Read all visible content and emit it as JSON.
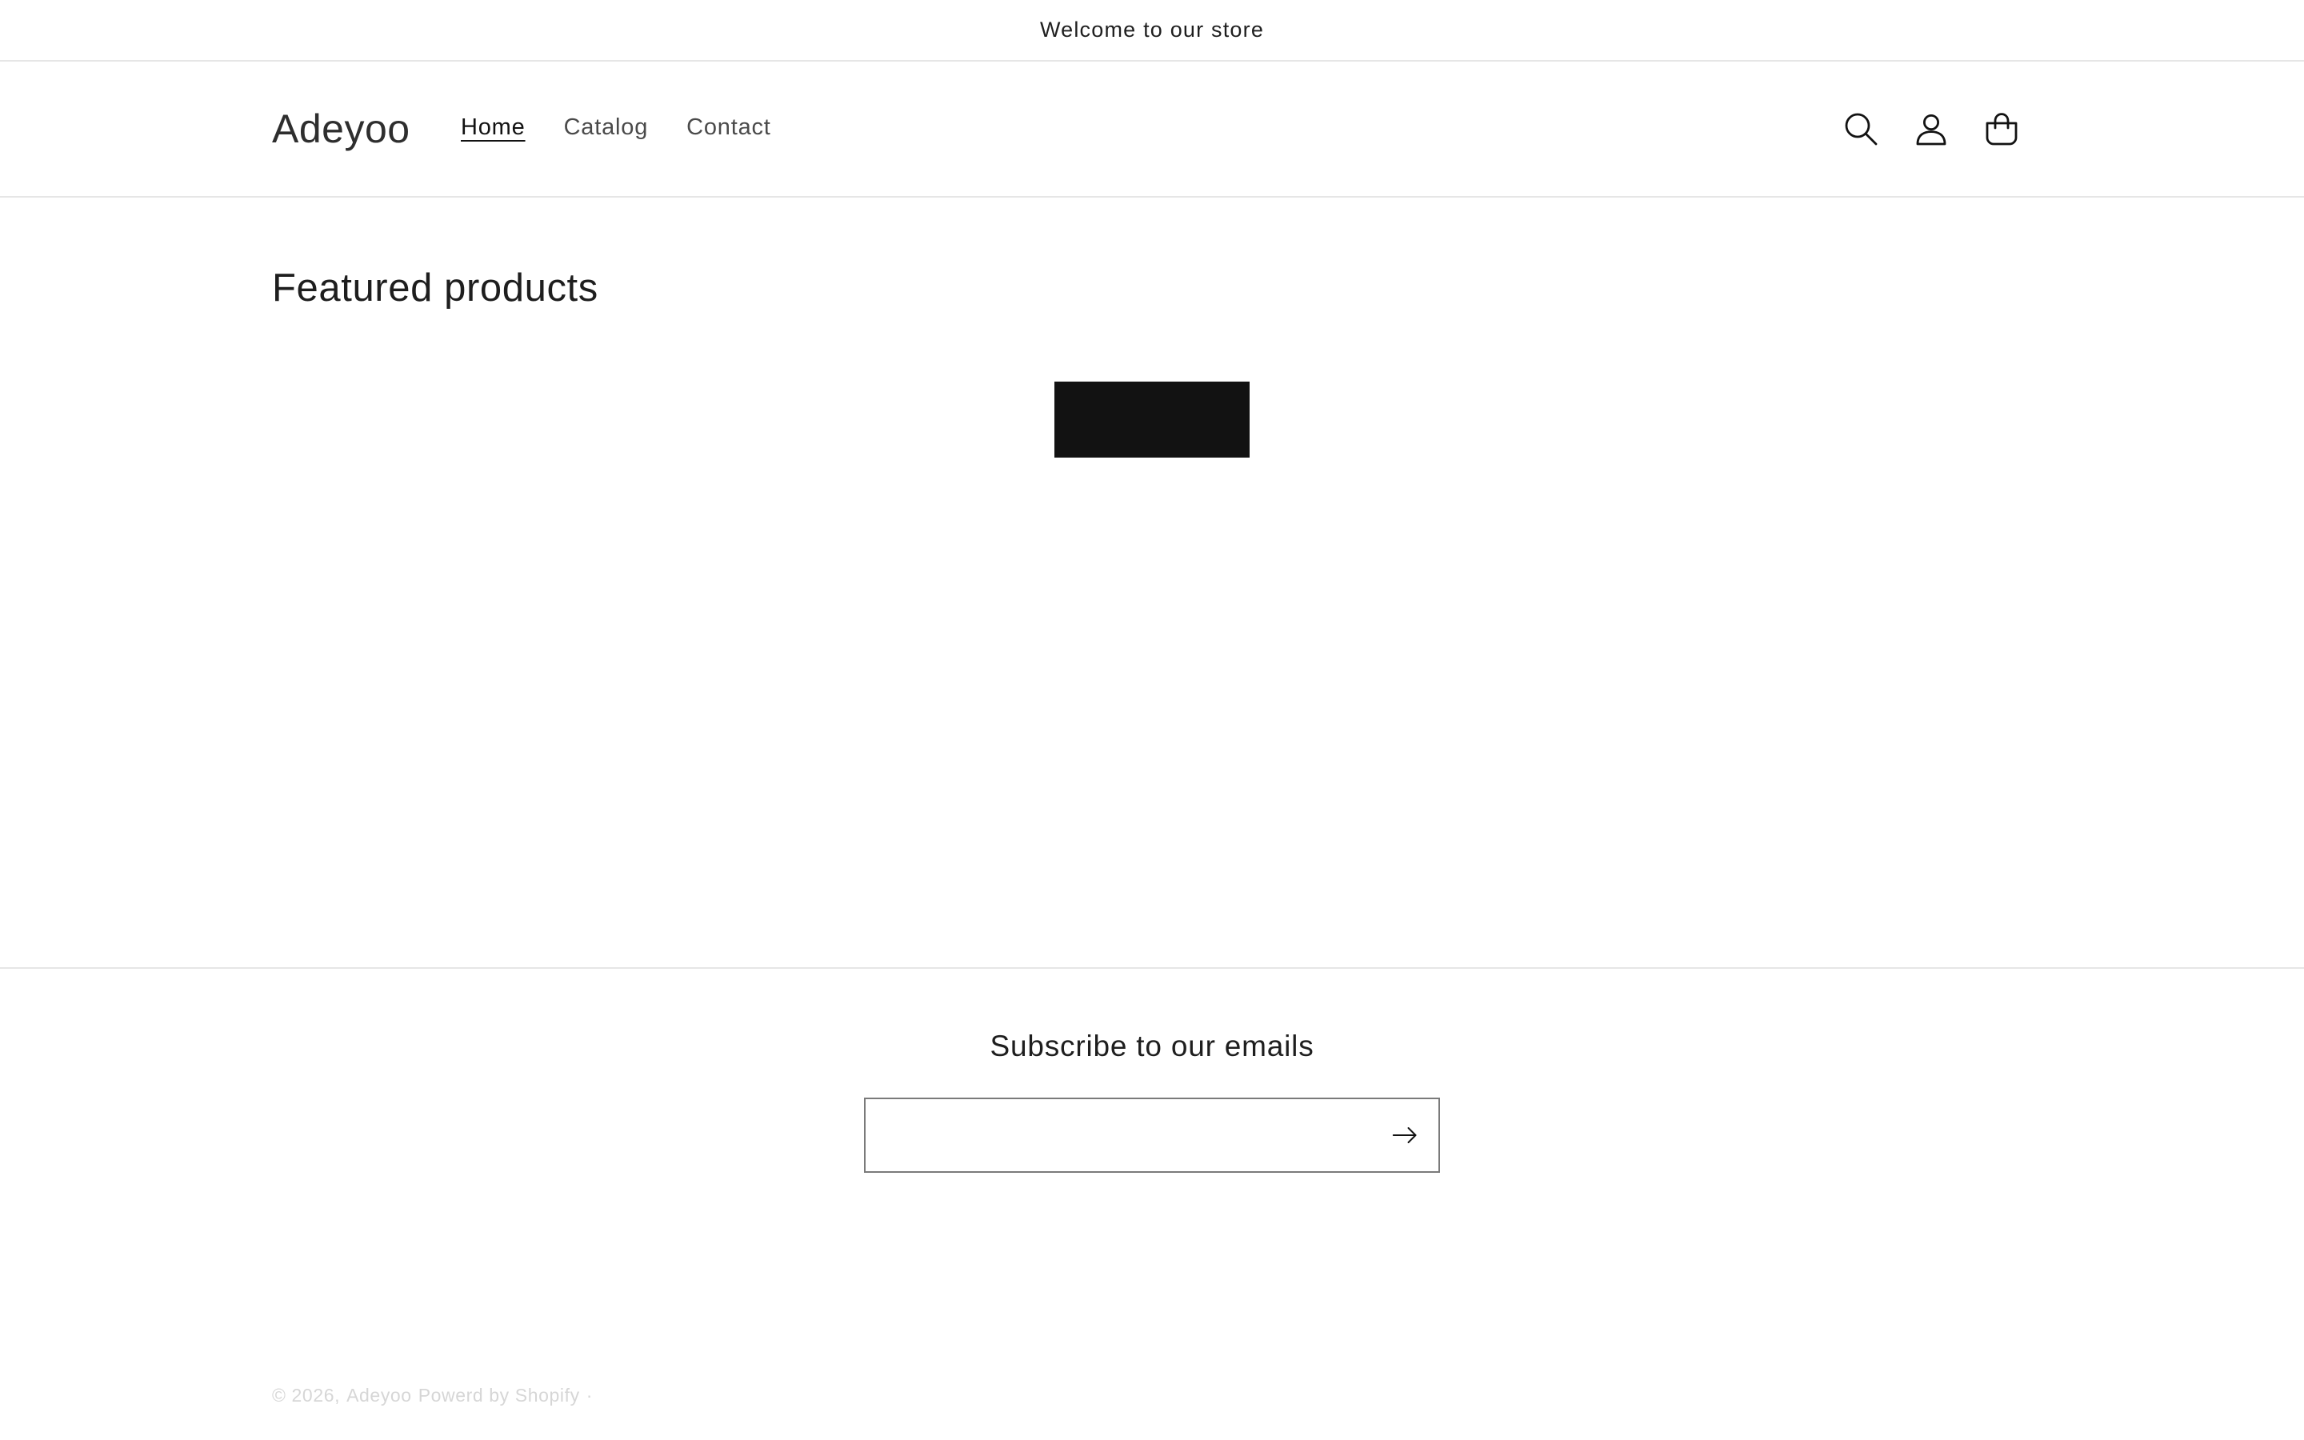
{
  "announcement": {
    "text": "Welcome to our store"
  },
  "header": {
    "logo": "Adeyoo",
    "nav": [
      {
        "label": "Home",
        "active": true
      },
      {
        "label": "Catalog",
        "active": false
      },
      {
        "label": "Contact",
        "active": false
      }
    ],
    "icons": [
      "search-icon",
      "account-icon",
      "cart-icon"
    ]
  },
  "featured": {
    "title": "Featured products",
    "button_label": ""
  },
  "footer": {
    "subscribe_title": "Subscribe to our emails",
    "email_value": "",
    "submit_icon": "arrow-right-icon",
    "copyright_prefix": "© 2026,",
    "copyright_store": "Adeyoo",
    "copyright_powered": "Powerd by Shopify",
    "copyright_separator": "·"
  },
  "colors": {
    "text": "#121212",
    "button_bg": "#121212",
    "border": "#e6e6e6",
    "muted": "#d6d6d6"
  }
}
